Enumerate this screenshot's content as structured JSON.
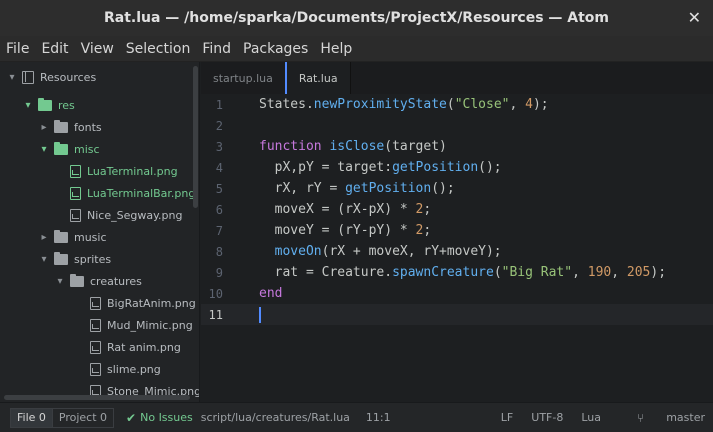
{
  "window": {
    "title": "Rat.lua — /home/sparka/Documents/ProjectX/Resources — Atom",
    "close": "✕"
  },
  "menu": [
    "File",
    "Edit",
    "View",
    "Selection",
    "Find",
    "Packages",
    "Help"
  ],
  "tree": {
    "root": "Resources",
    "items": [
      {
        "label": "res",
        "type": "folder",
        "open": true,
        "green": true
      },
      {
        "label": "fonts",
        "type": "folder",
        "open": false,
        "green": false
      },
      {
        "label": "misc",
        "type": "folder",
        "open": true,
        "green": true
      },
      {
        "label": "LuaTerminal.png",
        "type": "file",
        "green": true
      },
      {
        "label": "LuaTerminalBar.png",
        "type": "file",
        "green": true
      },
      {
        "label": "Nice_Segway.png",
        "type": "file",
        "green": false
      },
      {
        "label": "music",
        "type": "folder",
        "open": false,
        "green": false
      },
      {
        "label": "sprites",
        "type": "folder",
        "open": true,
        "green": false
      },
      {
        "label": "creatures",
        "type": "folder",
        "open": true,
        "green": false
      },
      {
        "label": "BigRatAnim.png",
        "type": "file",
        "green": false
      },
      {
        "label": "Mud_Mimic.png",
        "type": "file",
        "green": false
      },
      {
        "label": "Rat anim.png",
        "type": "file",
        "green": false
      },
      {
        "label": "slime.png",
        "type": "file",
        "green": false
      },
      {
        "label": "Stone_Mimic.png",
        "type": "file",
        "green": false
      }
    ]
  },
  "tabs": [
    {
      "label": "startup.lua",
      "active": false
    },
    {
      "label": "Rat.lua",
      "active": true
    }
  ],
  "editor": {
    "line_numbers": [
      "1",
      "2",
      "3",
      "4",
      "5",
      "6",
      "7",
      "8",
      "9",
      "10",
      "11"
    ],
    "current_line": "11"
  },
  "status": {
    "file_btn": "File 0",
    "project_btn": "Project 0",
    "issues": "No Issues",
    "path": "script/lua/creatures/Rat.lua",
    "cursor": "11:1",
    "line_ending": "LF",
    "encoding": "UTF-8",
    "grammar": "Lua",
    "branch": "master"
  },
  "colors": {
    "accent": "#528bff",
    "git_green": "#73c990",
    "keyword": "#c678dd",
    "function": "#61afef",
    "string": "#98c379",
    "number": "#d19a66"
  }
}
